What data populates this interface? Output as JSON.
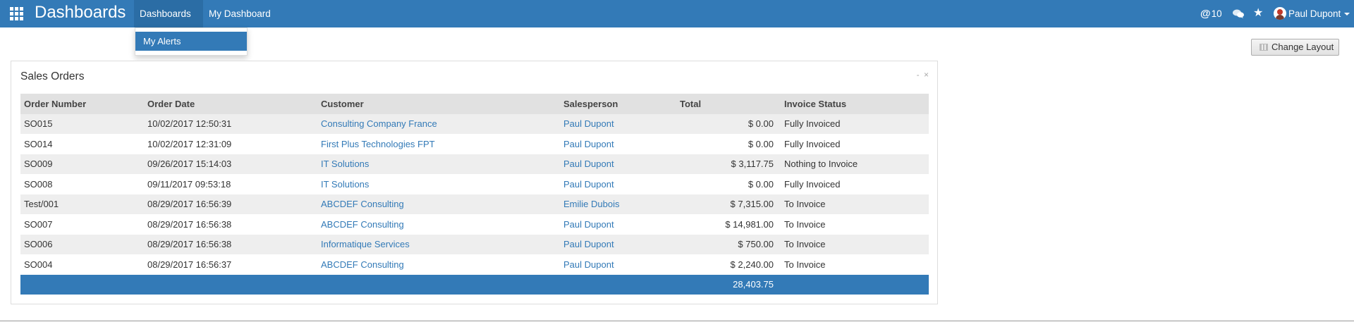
{
  "navbar": {
    "brand": "Dashboards",
    "menu": {
      "dashboards_label": "Dashboards",
      "my_dashboard_label": "My Dashboard"
    },
    "mentions_count": "10",
    "user_name": "Paul Dupont",
    "icons": {
      "apps": "apps-grid-icon",
      "chat": "chat-bubbles-icon",
      "star": "star-icon"
    }
  },
  "dropdown": {
    "item": "My Alerts"
  },
  "toolbar": {
    "change_layout_label": "Change Layout"
  },
  "panel": {
    "title": "Sales Orders",
    "controls": {
      "minimize": "-",
      "close": "×"
    },
    "columns": [
      "Order Number",
      "Order Date",
      "Customer",
      "Salesperson",
      "Total",
      "Invoice Status"
    ],
    "rows": [
      {
        "order": "SO015",
        "date": "10/02/2017 12:50:31",
        "customer": "Consulting Company France",
        "salesperson": "Paul Dupont",
        "total": "$ 0.00",
        "status": "Fully Invoiced"
      },
      {
        "order": "SO014",
        "date": "10/02/2017 12:31:09",
        "customer": "First Plus Technologies FPT",
        "salesperson": "Paul Dupont",
        "total": "$ 0.00",
        "status": "Fully Invoiced"
      },
      {
        "order": "SO009",
        "date": "09/26/2017 15:14:03",
        "customer": "IT Solutions",
        "salesperson": "Paul Dupont",
        "total": "$ 3,117.75",
        "status": "Nothing to Invoice"
      },
      {
        "order": "SO008",
        "date": "09/11/2017 09:53:18",
        "customer": "IT Solutions",
        "salesperson": "Paul Dupont",
        "total": "$ 0.00",
        "status": "Fully Invoiced"
      },
      {
        "order": "Test/001",
        "date": "08/29/2017 16:56:39",
        "customer": "ABCDEF Consulting",
        "salesperson": "Emilie Dubois",
        "total": "$ 7,315.00",
        "status": "To Invoice"
      },
      {
        "order": "SO007",
        "date": "08/29/2017 16:56:38",
        "customer": "ABCDEF Consulting",
        "salesperson": "Paul Dupont",
        "total": "$ 14,981.00",
        "status": "To Invoice"
      },
      {
        "order": "SO006",
        "date": "08/29/2017 16:56:38",
        "customer": "Informatique Services",
        "salesperson": "Paul Dupont",
        "total": "$ 750.00",
        "status": "To Invoice"
      },
      {
        "order": "SO004",
        "date": "08/29/2017 16:56:37",
        "customer": "ABCDEF Consulting",
        "salesperson": "Paul Dupont",
        "total": "$ 2,240.00",
        "status": "To Invoice"
      }
    ],
    "footer_total": "28,403.75"
  },
  "colors": {
    "primary": "#337ab7",
    "header_row": "#e1e1e1",
    "odd_row": "#eeeeee"
  }
}
